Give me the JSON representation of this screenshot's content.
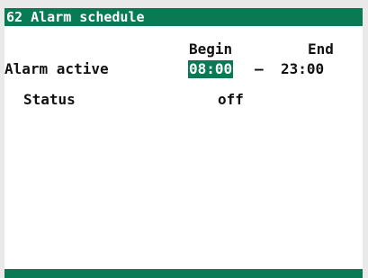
{
  "header": {
    "title": "62 Alarm schedule"
  },
  "columns": {
    "begin": "Begin",
    "end": "End"
  },
  "alarm_active": {
    "label": "Alarm active",
    "begin_value": "08:00",
    "separator": "–",
    "end_value": "23:00"
  },
  "status": {
    "label": "Status",
    "value": "off"
  },
  "colors": {
    "accent": "#0a7a55",
    "background": "#ffffff",
    "text": "#111111"
  }
}
